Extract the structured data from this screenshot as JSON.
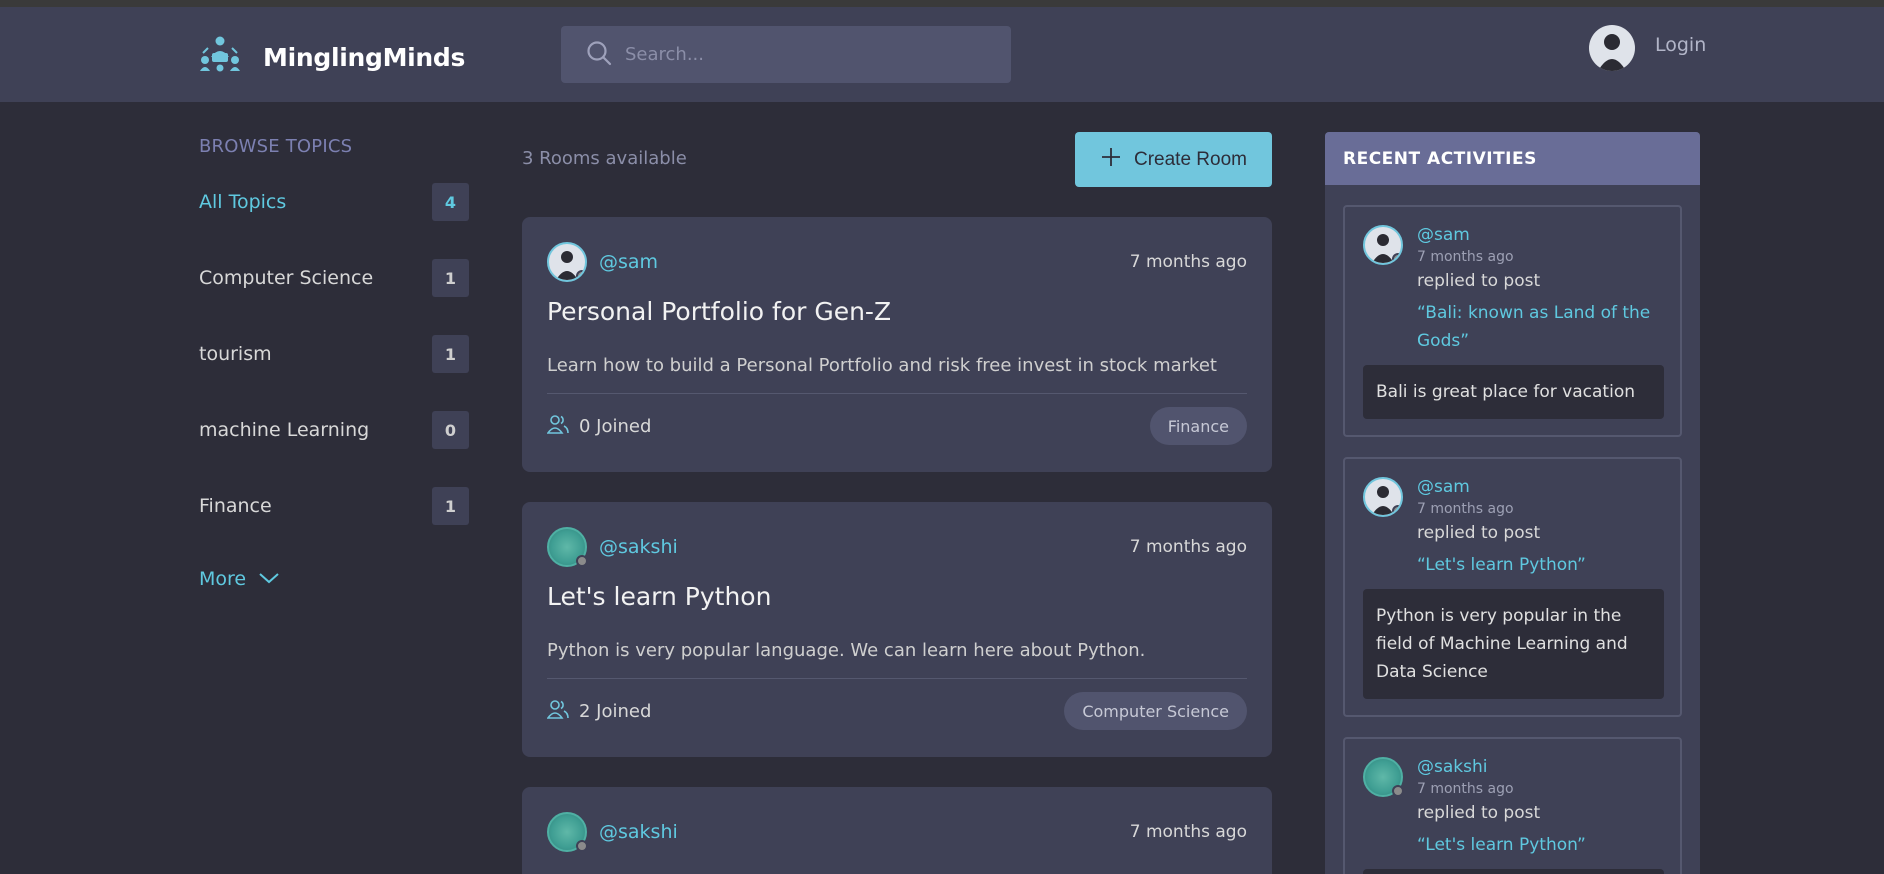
{
  "app": {
    "name": "MinglingMinds"
  },
  "search": {
    "placeholder": "Search..."
  },
  "auth": {
    "login_label": "Login"
  },
  "sidebar": {
    "title": "BROWSE TOPICS",
    "topics": [
      {
        "label": "All Topics",
        "count": "4"
      },
      {
        "label": "Computer Science",
        "count": "1"
      },
      {
        "label": "tourism",
        "count": "1"
      },
      {
        "label": "machine Learning",
        "count": "0"
      },
      {
        "label": "Finance",
        "count": "1"
      }
    ],
    "more_label": "More"
  },
  "main": {
    "rooms_count": "3 Rooms available",
    "create_label": "Create Room",
    "rooms": [
      {
        "host": "@sam",
        "time": "7 months ago",
        "title": "Personal Portfolio for Gen-Z",
        "description": "Learn how to build a Personal Portfolio and risk free invest in stock market",
        "joined": "0 Joined",
        "topic": "Finance"
      },
      {
        "host": "@sakshi",
        "time": "7 months ago",
        "title": "Let's learn Python",
        "description": "Python is very popular language. We can learn here about Python.",
        "joined": "2 Joined",
        "topic": "Computer Science"
      },
      {
        "host": "@sakshi",
        "time": "7 months ago"
      }
    ]
  },
  "activity": {
    "title": "RECENT ACTIVITIES",
    "items": [
      {
        "user": "@sam",
        "time": "7 months ago",
        "action": "replied to post",
        "post": "“Bali: known as Land of the Gods”",
        "message": "Bali is great place for vacation"
      },
      {
        "user": "@sam",
        "time": "7 months ago",
        "action": "replied to post",
        "post": "“Let's learn Python”",
        "message": "Python is very popular in the field of Machine Learning and Data Science"
      },
      {
        "user": "@sakshi",
        "time": "7 months ago",
        "action": "replied to post",
        "post": "“Let's learn Python”"
      }
    ]
  },
  "colors": {
    "accent": "#71c6dd",
    "link": "#5fc9e0",
    "bg": "#2d2d39",
    "surface": "#3f4156",
    "activity_header": "#696d97"
  },
  "icons": [
    "logo-icon",
    "search-icon",
    "user-avatar-icon",
    "plus-icon",
    "users-icon",
    "chevron-down-icon"
  ]
}
